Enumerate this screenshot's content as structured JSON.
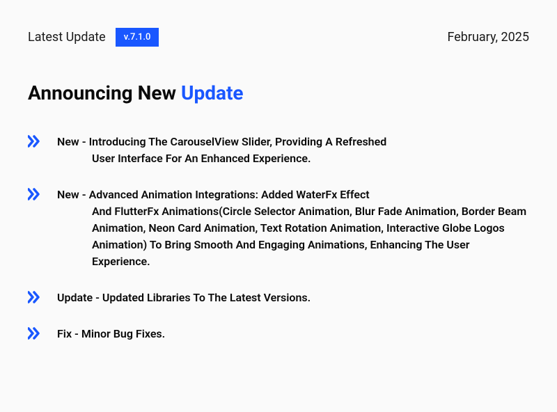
{
  "header": {
    "label": "Latest Update",
    "version": "v.7.1.0",
    "date": "February, 2025"
  },
  "title": {
    "prefix": "Announcing New ",
    "highlight": "Update"
  },
  "changes": [
    {
      "tag": "New",
      "firstLine": "Introducing The CarouselView Slider, Providing A Refreshed",
      "rest": "User Interface For An Enhanced Experience.",
      "indented": true
    },
    {
      "tag": "New",
      "firstLine": "Advanced Animation Integrations: Added WaterFx Effect",
      "rest": "And FlutterFx Animations(Circle Selector Animation, Blur Fade Animation, Border Beam Animation, Neon Card Animation, Text Rotation Animation, Interactive Globe Logos Animation) To Bring Smooth And Engaging Animations, Enhancing The User Experience.",
      "indented": true
    },
    {
      "tag": "Update",
      "firstLine": "Updated Libraries To The Latest Versions.",
      "rest": "",
      "indented": false
    },
    {
      "tag": "Fix",
      "firstLine": "Minor Bug Fixes.",
      "rest": "",
      "indented": false
    }
  ]
}
